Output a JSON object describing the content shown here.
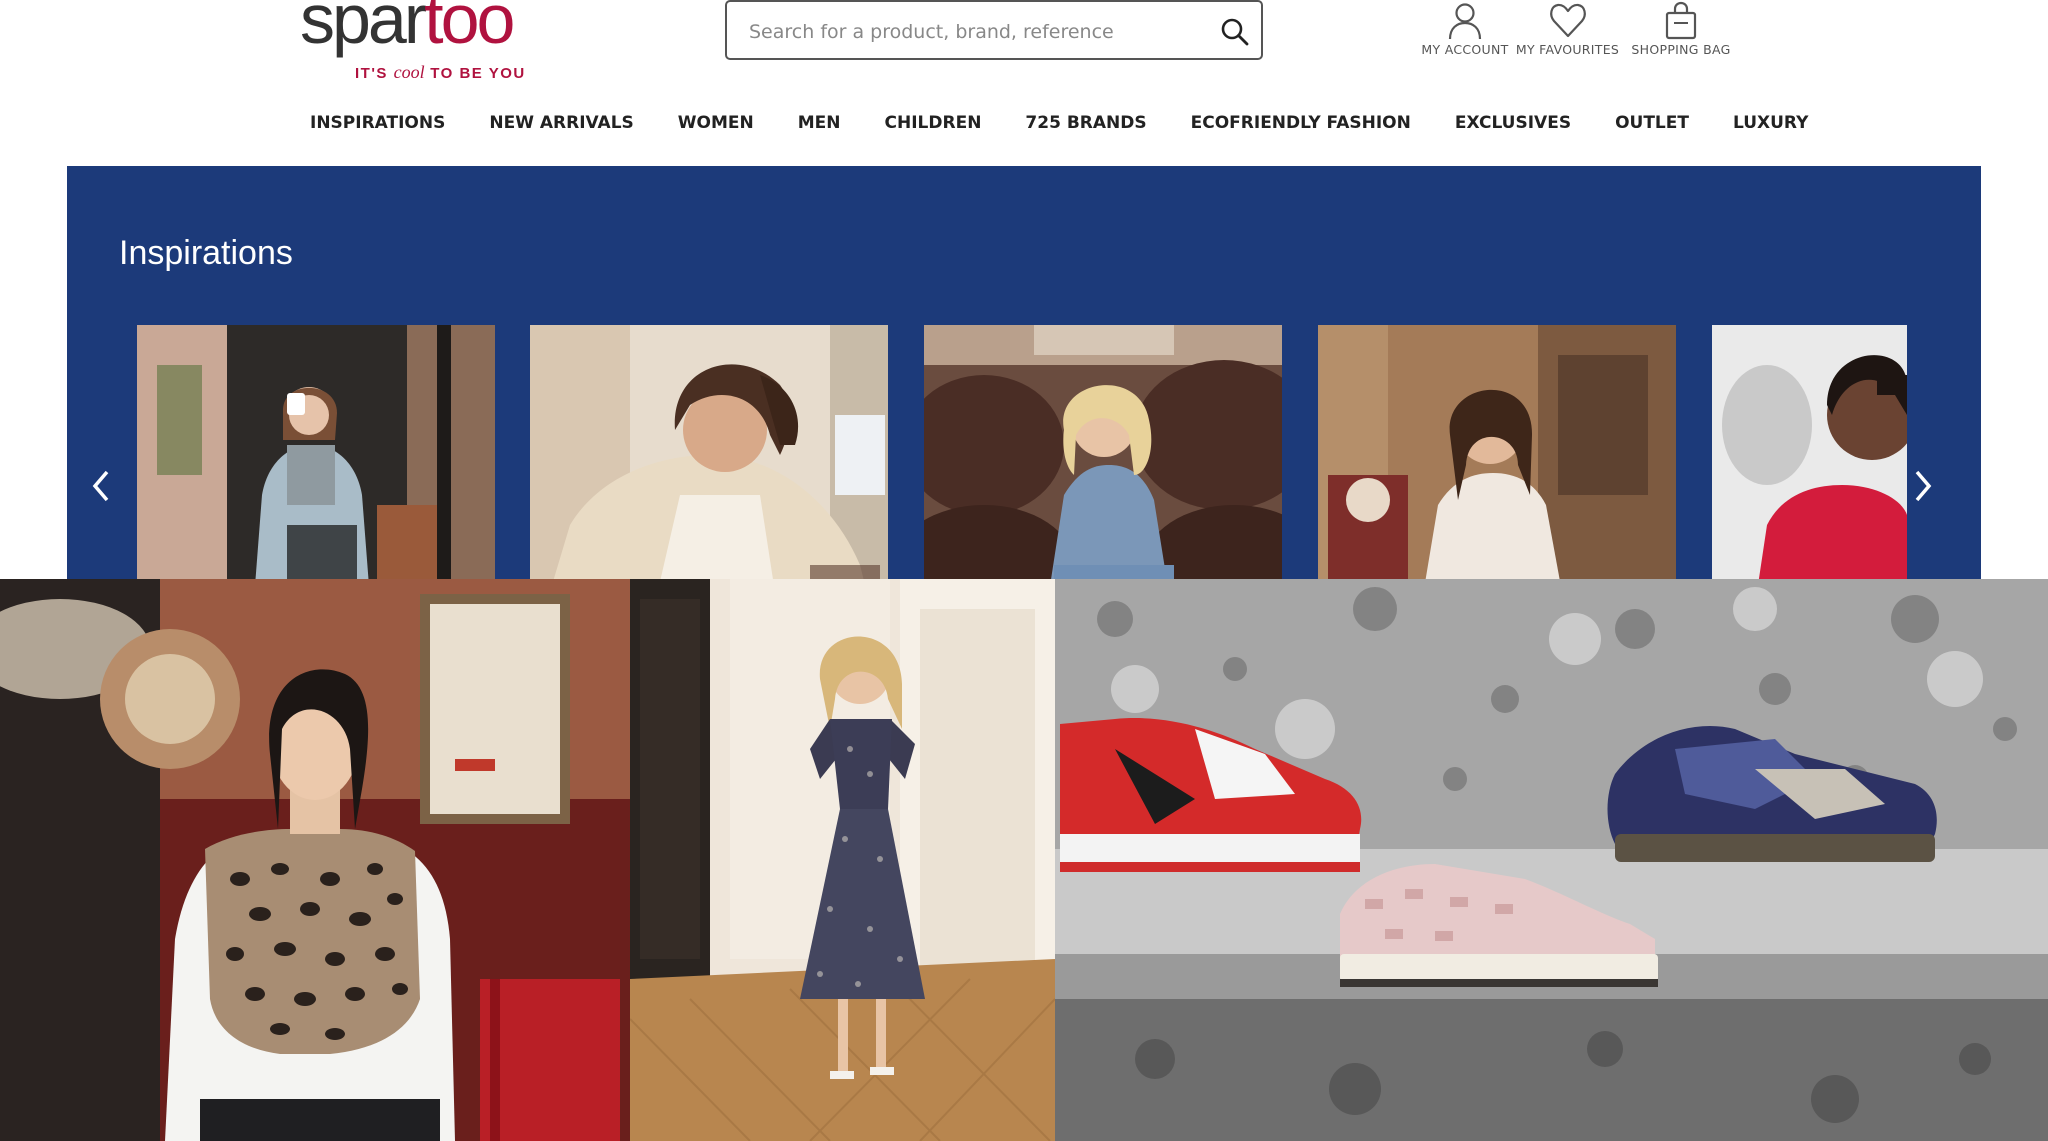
{
  "brand": {
    "logo_left": "spar",
    "logo_right": "too",
    "tagline_pre": "IT'S ",
    "tagline_mid": "cool",
    "tagline_post": " TO BE YOU"
  },
  "search": {
    "placeholder": "Search for a product, brand, reference",
    "value": ""
  },
  "header_links": {
    "account": "MY ACCOUNT",
    "favourites": "MY FAVOURITES",
    "bag": "SHOPPING BAG"
  },
  "nav": {
    "items": [
      "INSPIRATIONS",
      "NEW ARRIVALS",
      "WOMEN",
      "MEN",
      "CHILDREN",
      "725 BRANDS",
      "ECOFRIENDLY FASHION",
      "EXCLUSIVES",
      "OUTLET",
      "LUXURY"
    ]
  },
  "inspirations": {
    "title": "Inspirations"
  },
  "colors": {
    "brand_red": "#b0123f",
    "banner_blue": "#1c3a7a",
    "text_dark": "#222222"
  },
  "icons": {
    "search": "search-icon",
    "account": "user-icon",
    "favourites": "heart-icon",
    "bag": "shopping-bag-icon",
    "prev": "chevron-left-icon",
    "next": "chevron-right-icon"
  }
}
